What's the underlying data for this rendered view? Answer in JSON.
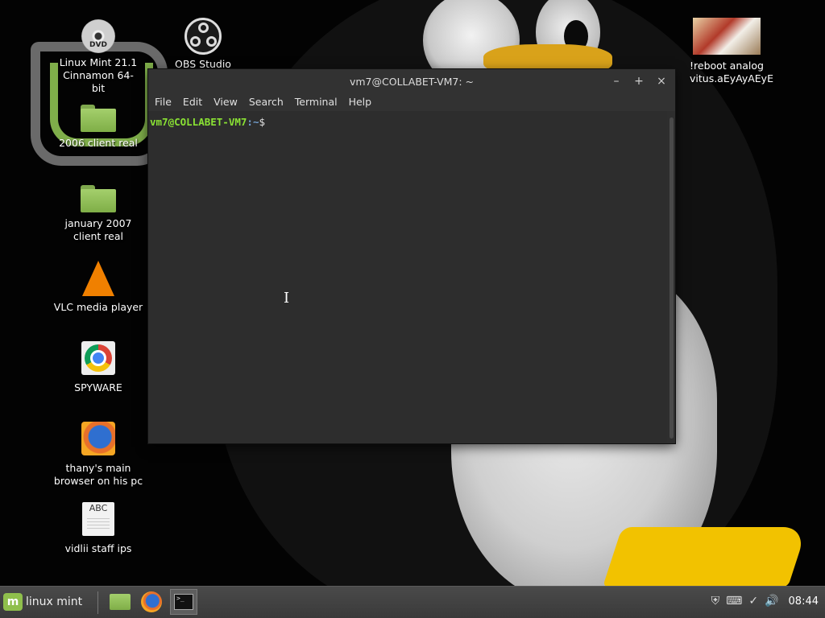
{
  "desktop": {
    "icons": [
      {
        "label": "Linux Mint 21.1 Cinnamon 64-bit",
        "dvd_text": "DVD"
      },
      {
        "label": "OBS Studio"
      },
      {
        "label": "!reboot analog vitus.aEyAyAEyE"
      },
      {
        "label": "2006 client real"
      },
      {
        "label": "january 2007 client real"
      },
      {
        "label": "VLC media player"
      },
      {
        "label": "SPYWARE"
      },
      {
        "label": "thany's main browser on his pc"
      },
      {
        "label": "vidlii staff ips",
        "doc_text": "ABC"
      }
    ]
  },
  "terminal": {
    "title": "vm7@COLLABET-VM7: ~",
    "menu": [
      "File",
      "Edit",
      "View",
      "Search",
      "Terminal",
      "Help"
    ],
    "prompt_user": "vm7@COLLABET-VM7",
    "prompt_path": ":~",
    "prompt_symbol": "$",
    "minimize": "–",
    "maximize": "+",
    "close": "×"
  },
  "taskbar": {
    "menu_label": "linux mint",
    "menu_badge": "m",
    "clock": "08:44"
  },
  "colors": {
    "prompt_user": "#8ae234",
    "prompt_path": "#729fcf",
    "mint_green": "#8fbf4c"
  },
  "icons": {
    "tray": [
      "shield-icon",
      "keyboard-icon",
      "network-icon",
      "volume-icon"
    ]
  }
}
